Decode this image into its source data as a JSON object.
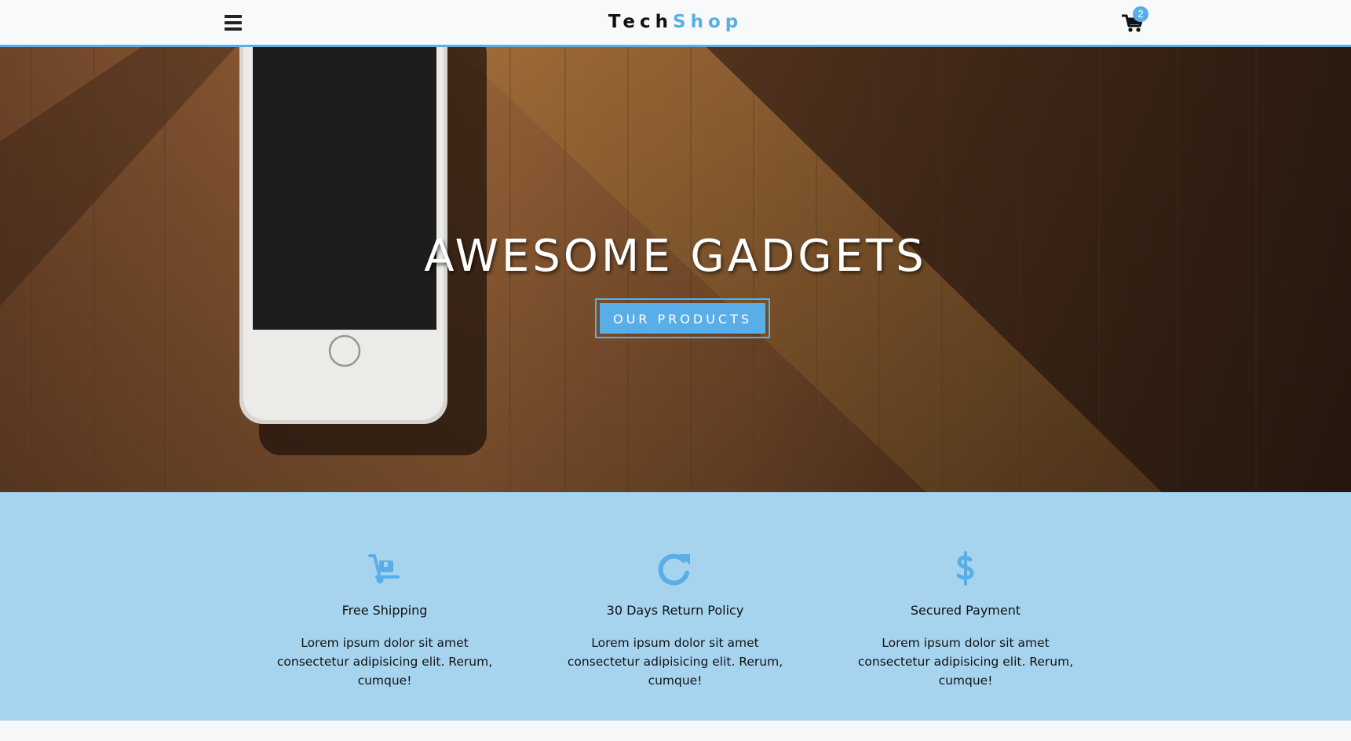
{
  "navbar": {
    "brand_part1": "Tech",
    "brand_part2": "Shop",
    "cart_count": "2",
    "menu_icon": "hamburger-icon",
    "cart_icon": "shopping-cart-icon",
    "accent_color": "#5aaee8"
  },
  "hero": {
    "title": "AWESOME GADGETS",
    "button_label": "OUR PRODUCTS"
  },
  "features": [
    {
      "icon": "dolly-icon",
      "title": "Free Shipping",
      "text": "Lorem ipsum dolor sit amet consectetur adipisicing elit. Rerum, cumque!"
    },
    {
      "icon": "redo-icon",
      "title": "30 Days Return Policy",
      "text": "Lorem ipsum dolor sit amet consectetur adipisicing elit. Rerum, cumque!"
    },
    {
      "icon": "dollar-icon",
      "title": "Secured Payment",
      "text": "Lorem ipsum dolor sit amet consectetur adipisicing elit. Rerum, cumque!"
    }
  ],
  "colors": {
    "features_bg": "#a6d4ef",
    "icon_color": "#5aaee8"
  }
}
